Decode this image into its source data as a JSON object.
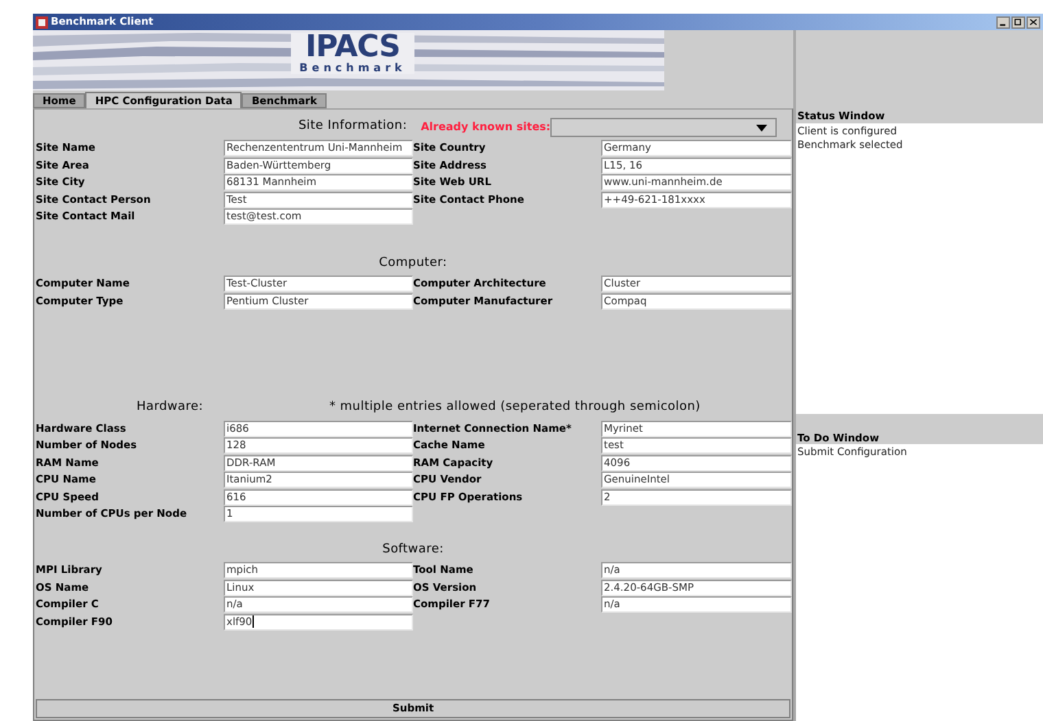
{
  "window": {
    "title": "Benchmark Client"
  },
  "logo": {
    "name": "IPACS",
    "subtitle": "Benchmark"
  },
  "tabs": [
    {
      "label": "Home",
      "selected": false
    },
    {
      "label": "HPC Configuration Data",
      "selected": true
    },
    {
      "label": "Benchmark",
      "selected": false
    }
  ],
  "sections": [
    {
      "kind": "site",
      "title": "Site Information:",
      "known_sites_label": "Already known sites:",
      "rows": [
        {
          "label": "Site Name",
          "value": "Rechenzententrum Uni-Mannheim",
          "label2": "Site Country",
          "value2": "Germany"
        },
        {
          "label": "Site Area",
          "value": "Baden-Württemberg",
          "label2": "Site Address",
          "value2": "L15, 16"
        },
        {
          "label": "Site City",
          "value": "68131 Mannheim",
          "label2": "Site Web URL",
          "value2": "www.uni-mannheim.de"
        },
        {
          "label": "Site Contact Person",
          "value": "Test",
          "label2": "Site Contact Phone",
          "value2": "++49-621-181xxxx"
        },
        {
          "label": "Site Contact Mail",
          "value": "test@test.com"
        }
      ]
    },
    {
      "kind": "centered",
      "title": "Computer:",
      "rows": [
        {
          "label": "Computer Name",
          "value": "Test-Cluster",
          "label2": "Computer Architecture",
          "value2": "Cluster"
        },
        {
          "label": "Computer Type",
          "value": "Pentium Cluster",
          "label2": "Computer Manufacturer",
          "value2": "Compaq"
        }
      ]
    },
    {
      "kind": "split",
      "title": "Hardware:",
      "note": "* multiple entries allowed (seperated through semicolon)",
      "rows": [
        {
          "label": "Hardware Class",
          "value": "i686",
          "label2": "Internet Connection Name*",
          "value2": "Myrinet"
        },
        {
          "label": "Number of Nodes",
          "value": "128",
          "label2": "Cache Name",
          "value2": "test"
        },
        {
          "label": "RAM Name",
          "value": "DDR-RAM",
          "label2": "RAM Capacity",
          "value2": "4096"
        },
        {
          "label": "CPU Name",
          "value": "Itanium2",
          "label2": "CPU Vendor",
          "value2": "GenuineIntel"
        },
        {
          "label": "CPU Speed",
          "value": "616",
          "label2": "CPU FP Operations",
          "value2": "2"
        },
        {
          "label": "Number of CPUs per Node",
          "value": "1"
        }
      ]
    },
    {
      "kind": "centered",
      "title": "Software:",
      "rows": [
        {
          "label": "MPI Library",
          "value": "mpich",
          "label2": "Tool Name",
          "value2": "n/a"
        },
        {
          "label": "OS Name",
          "value": "Linux",
          "label2": "OS Version",
          "value2": "2.4.20-64GB-SMP"
        },
        {
          "label": "Compiler C",
          "value": "n/a",
          "label2": "Compiler F77",
          "value2": "n/a"
        },
        {
          "label": "Compiler F90",
          "value": "xlf90",
          "focused": true
        }
      ]
    }
  ],
  "submit": "Submit",
  "status_window": {
    "title": "Status Window",
    "lines": [
      "Client is configured",
      "Benchmark selected"
    ]
  },
  "todo_window": {
    "title": "To Do Window",
    "lines": [
      "Submit Configuration"
    ]
  }
}
